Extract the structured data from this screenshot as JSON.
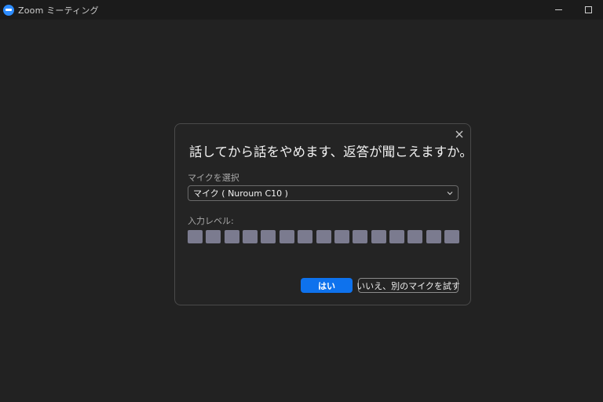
{
  "window": {
    "title": "Zoom ミーティング",
    "icon": "zoom-logo-icon"
  },
  "dialog": {
    "title": "話してから話をやめます、返答が聞こえますか。",
    "mic_label": "マイクを選択",
    "mic_selected": "マイク ( Nuroum C10 )",
    "level_label": "入力レベル:",
    "level_segments": 15,
    "level_value": 0,
    "yes_label": "はい",
    "no_label": "いいえ、別のマイクを試す"
  },
  "colors": {
    "accent": "#0e72ed",
    "background": "#222222",
    "dialog": "#242424",
    "meter_segment": "#7b7b8f"
  }
}
